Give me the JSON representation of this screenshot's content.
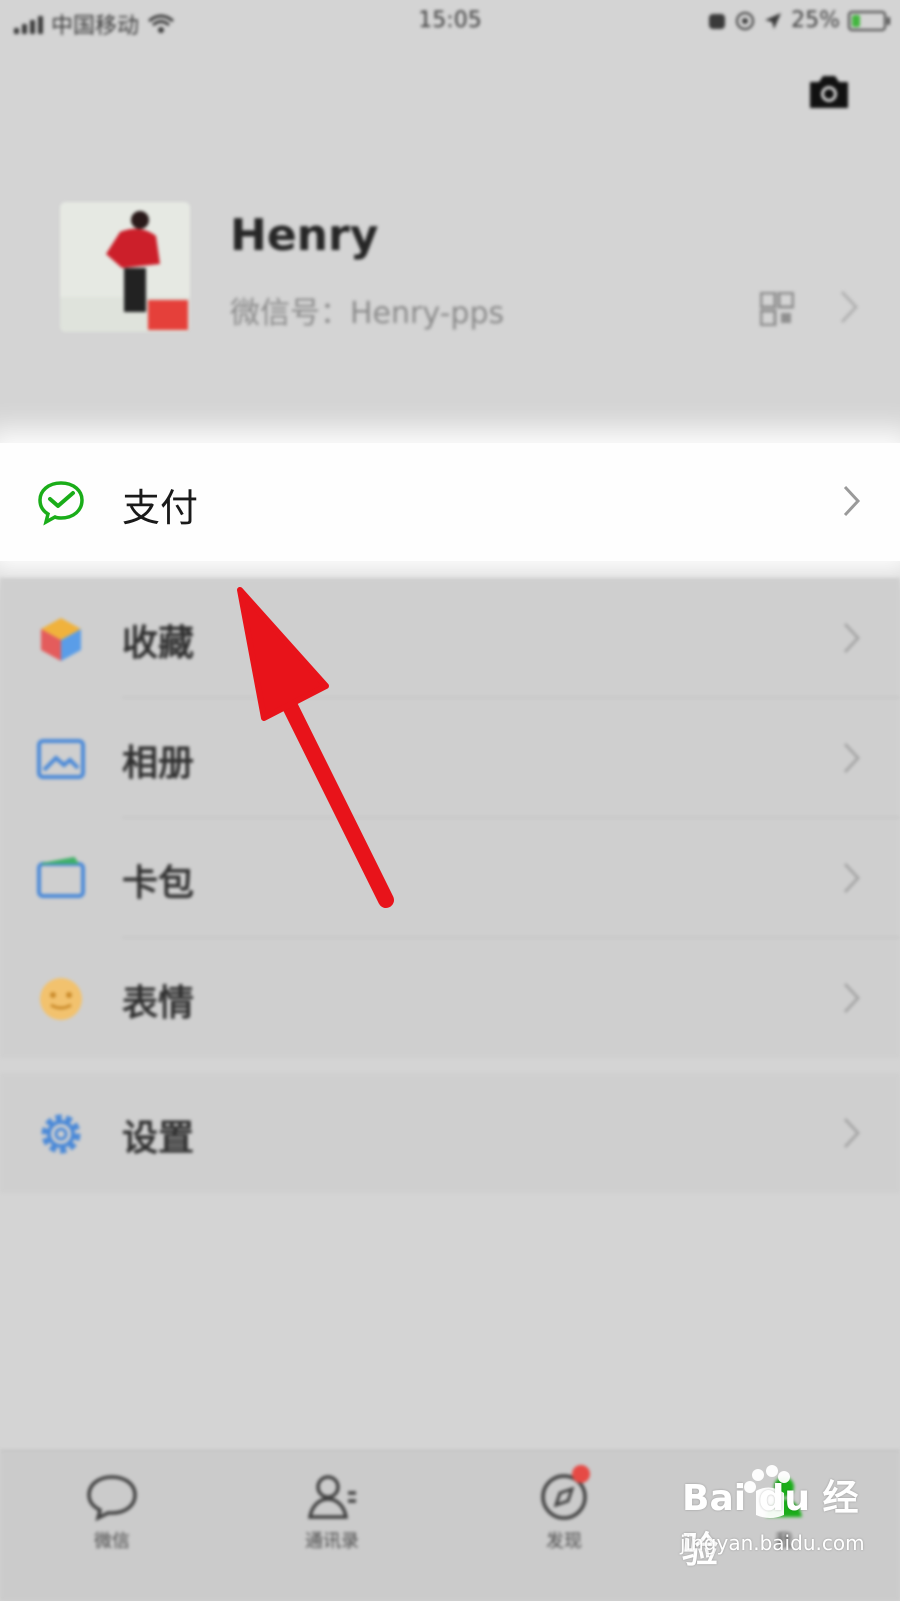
{
  "status_bar": {
    "carrier": "中国移动",
    "time": "15:05",
    "battery": "25%",
    "battery_level": 0.25
  },
  "header": {
    "camera_icon": "camera-icon"
  },
  "profile": {
    "name": "Henry",
    "wechat_id": "微信号：Henry-pps",
    "qr_icon": "qr-code-icon"
  },
  "pay": {
    "label": "支付",
    "icon": "wechat-pay-icon",
    "icon_color": "#1aad19"
  },
  "menu": {
    "items": [
      {
        "label": "收藏",
        "icon": "favorites-cube-icon"
      },
      {
        "label": "相册",
        "icon": "album-picture-icon"
      },
      {
        "label": "卡包",
        "icon": "card-wallet-icon"
      },
      {
        "label": "表情",
        "icon": "sticker-face-icon"
      }
    ]
  },
  "settings": {
    "label": "设置",
    "icon": "gear-icon"
  },
  "tabbar": {
    "items": [
      {
        "label": "微信",
        "icon": "chat-bubble-icon"
      },
      {
        "label": "通讯录",
        "icon": "contacts-icon"
      },
      {
        "label": "发现",
        "icon": "compass-icon",
        "badge": true
      },
      {
        "label": "我",
        "icon": "person-icon"
      }
    ]
  },
  "annotation": {
    "arrow_color": "#e8131a"
  },
  "watermark": {
    "brand": "Bai du 经验",
    "url": "jingyan.baidu.com"
  }
}
